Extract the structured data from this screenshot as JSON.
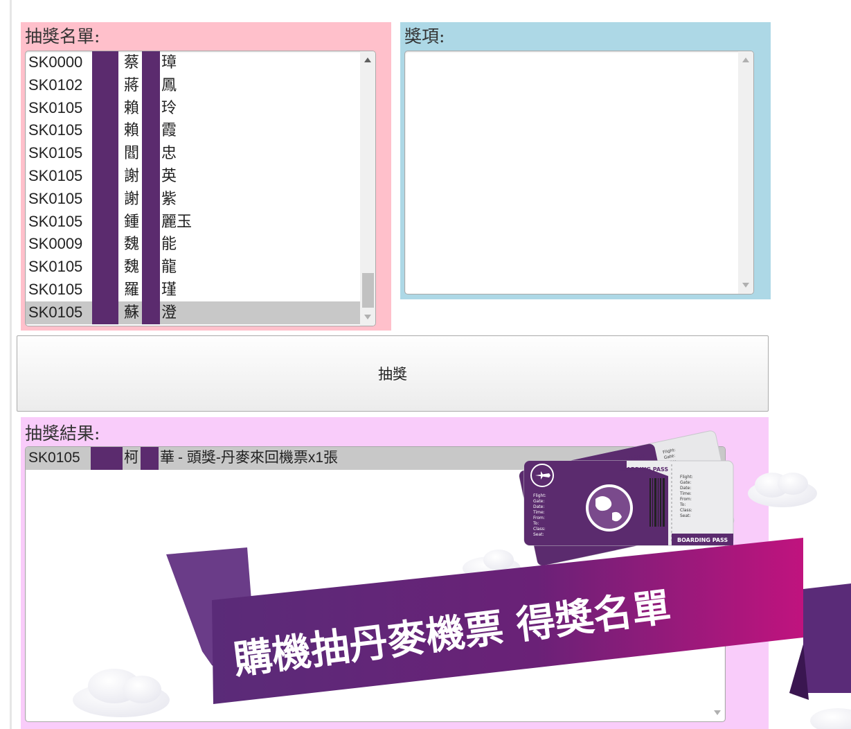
{
  "draw_list": {
    "label": "抽獎名單:",
    "entries": [
      {
        "id": "SK0000",
        "surname": "蔡",
        "given": "璋",
        "selected": false
      },
      {
        "id": "SK0102",
        "surname": "蔣",
        "given": "鳳",
        "selected": false
      },
      {
        "id": "SK0105",
        "surname": "賴",
        "given": "玲",
        "selected": false
      },
      {
        "id": "SK0105",
        "surname": "賴",
        "given": "霞",
        "selected": false
      },
      {
        "id": "SK0105",
        "surname": "閻",
        "given": "忠",
        "selected": false
      },
      {
        "id": "SK0105",
        "surname": "謝",
        "given": "英",
        "selected": false
      },
      {
        "id": "SK0105",
        "surname": "謝",
        "given": "紫",
        "selected": false
      },
      {
        "id": "SK0105",
        "surname": "鍾",
        "given": "麗玉",
        "selected": false
      },
      {
        "id": "SK0009",
        "surname": "魏",
        "given": "能",
        "selected": false
      },
      {
        "id": "SK0105",
        "surname": "魏",
        "given": "龍",
        "selected": false
      },
      {
        "id": "SK0105",
        "surname": "羅",
        "given": "瑾",
        "selected": false
      },
      {
        "id": "SK0105",
        "surname": "蘇",
        "given": "澄",
        "selected": true
      }
    ]
  },
  "prizes": {
    "label": "獎項:",
    "entries": []
  },
  "draw_button": {
    "label": "抽獎"
  },
  "results": {
    "label": "抽獎結果:",
    "entries": [
      {
        "id": "SK0105",
        "surname": "柯",
        "given": "華",
        "prize": " - 頭獎-丹麥來回機票x1張",
        "selected": true
      }
    ]
  },
  "banner": {
    "headline": "購機抽丹麥機票 得獎名單",
    "ticket_title": "BOARDING PASS",
    "ticket_fields": [
      "Flight:",
      "Gate:",
      "Date:",
      "Time:",
      "From:",
      "To:",
      "Class:",
      "Seat:"
    ],
    "ticket_side_fields": [
      "Flight:",
      "Gate:",
      "Date:",
      "Time:",
      "From:",
      "To:",
      "Class:",
      "Seat:"
    ]
  },
  "colors": {
    "draw_list_bg": "#ffc0cb",
    "prizes_bg": "#add8e6",
    "results_bg": "#f9ccfa",
    "redaction": "#5b2b6e",
    "ribbon_start": "#5a2b78",
    "ribbon_end": "#c0137e"
  }
}
